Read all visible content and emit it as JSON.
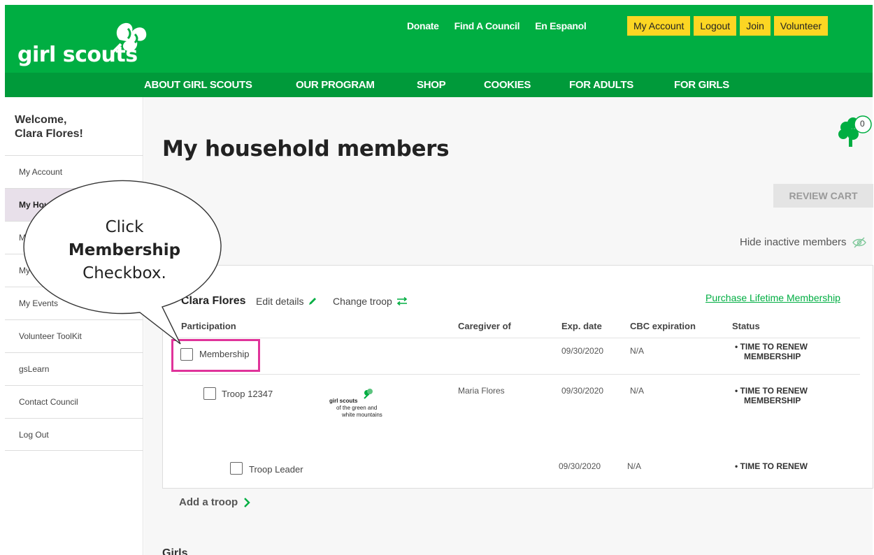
{
  "brand": {
    "logo_text": "girl scouts"
  },
  "top_links": [
    "Donate",
    "Find A Council",
    "En Espanol"
  ],
  "account_buttons": [
    "My Account",
    "Logout",
    "Join",
    "Volunteer"
  ],
  "nav": [
    "ABOUT GIRL SCOUTS",
    "OUR PROGRAM",
    "SHOP",
    "COOKIES",
    "FOR ADULTS",
    "FOR GIRLS"
  ],
  "sidebar": {
    "welcome_line1": "Welcome,",
    "welcome_line2": "Clara Flores!",
    "items": [
      {
        "label": "My Account",
        "active": false
      },
      {
        "label": "My Household",
        "active": true
      },
      {
        "label": "My Troops",
        "active": false
      },
      {
        "label": "My Payments",
        "active": false
      },
      {
        "label": "My Events",
        "active": false
      },
      {
        "label": "Volunteer ToolKit",
        "active": false
      },
      {
        "label": "gsLearn",
        "active": false
      },
      {
        "label": "Contact Council",
        "active": false
      },
      {
        "label": "Log Out",
        "active": false
      }
    ]
  },
  "main": {
    "title": "My household members",
    "cart_count": "0",
    "review_cart": "REVIEW CART",
    "hide_inactive": "Hide inactive members",
    "member": {
      "name": "Clara Flores",
      "edit_details": "Edit details",
      "change_troop": "Change troop",
      "purchase_lifetime": "Purchase Lifetime Membership"
    },
    "columns": [
      "Participation",
      "Caregiver of",
      "Exp. date",
      "CBC expiration",
      "Status"
    ],
    "rows": [
      {
        "label": "Membership",
        "caregiver": "",
        "exp": "09/30/2020",
        "cbc": "N/A",
        "status1": "• TIME TO RENEW",
        "status2": "MEMBERSHIP"
      },
      {
        "label": "Troop 12347",
        "caregiver": "Maria Flores",
        "exp": "09/30/2020",
        "cbc": "N/A",
        "status1": "• TIME TO RENEW",
        "status2": "MEMBERSHIP"
      },
      {
        "label": "Troop Leader",
        "caregiver": "",
        "exp": "09/30/2020",
        "cbc": "N/A",
        "status1": "• TIME TO RENEW",
        "status2": ""
      }
    ],
    "council_logo": {
      "line1": "girl scouts",
      "line2": "of the green and",
      "line3": "white mountains"
    },
    "add_troop": "Add a troop",
    "girls_heading": "Girls"
  },
  "callout": {
    "line1": "Click",
    "line2": "Membership",
    "line3": "Checkbox."
  },
  "colors": {
    "green": "#00ae42",
    "dark_green": "#009a3a",
    "yellow": "#fcd623",
    "highlight": "#e0339a"
  }
}
